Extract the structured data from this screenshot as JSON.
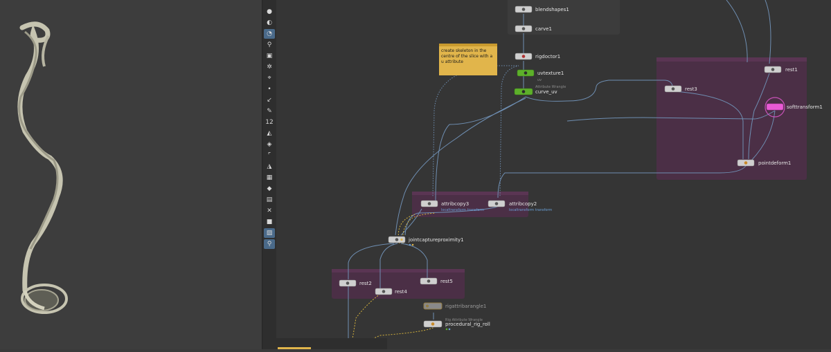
{
  "toolbar": {
    "icons": [
      "view-icon",
      "display-options-icon",
      "light-icon",
      "light-bulb-icon",
      "handle-icon",
      "snap-icon",
      "orient-icon",
      "point-icon",
      "edge-icon",
      "pen-icon",
      "guide-12-icon",
      "shade-icon",
      "template-icon",
      "bounds-icon",
      "grid-icon",
      "ghost-icon",
      "geometry-icon",
      "texture-icon",
      "wire-icon",
      "cube-icon",
      "background-icon",
      "pin-icon"
    ],
    "guide_label": "12"
  },
  "sticky_note": {
    "text": "create skeleton in the centre of the slice with a u attribute"
  },
  "nodes": {
    "blendshapes1": "blendshapes1",
    "carve1": "carve1",
    "rigdoctor1": "rigdoctor1",
    "uvtexture1": "uvtexture1",
    "uvtexture1_sub": "uv",
    "curve_uv_caption": "Attribute Wrangle",
    "curve_uv": "curve_uv",
    "rest1": "rest1",
    "rest3": "rest3",
    "softtransform1": "softtransform1",
    "pointdeform1": "pointdeform1",
    "attribcopy3": "attribcopy3",
    "attribcopy3_sub": "localtransform transform",
    "attribcopy2": "attribcopy2",
    "attribcopy2_sub": "localtransform transform",
    "jointcaptureproximity1": "jointcaptureproximity1",
    "rest2": "rest2",
    "rest4": "rest4",
    "rest5": "rest5",
    "rigattributeangle1": "rigattribarangle1",
    "procedural_rig_roll_caption": "Rig Attribute Wrangle",
    "procedural_rig_roll": "procedural_rig_roll"
  },
  "colors": {
    "network_bg": "#353535",
    "netbox_dark": "#3c3c3c",
    "netbox_purple": "#4b2f46",
    "wire": "#6f8fb3",
    "sticky": "#e1b54b",
    "uv_node": "#5db02a",
    "soft_node": "#e85ad4"
  }
}
